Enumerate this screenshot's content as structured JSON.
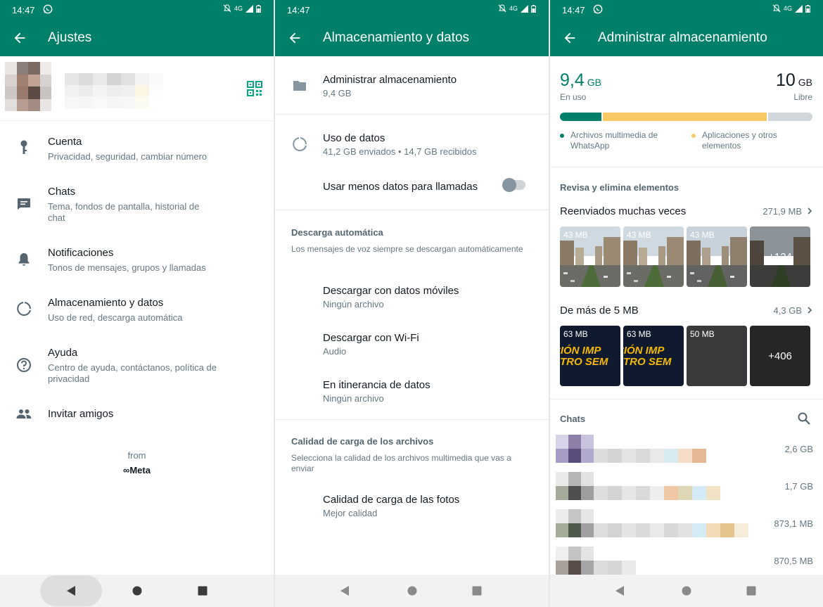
{
  "status_time": "14:47",
  "network": "4G",
  "settings": {
    "title": "Ajustes",
    "items": [
      {
        "label": "Cuenta",
        "sub": "Privacidad, seguridad, cambiar número"
      },
      {
        "label": "Chats",
        "sub": "Tema, fondos de pantalla, historial de chat"
      },
      {
        "label": "Notificaciones",
        "sub": "Tonos de mensajes, grupos y llamadas"
      },
      {
        "label": "Almacenamiento y datos",
        "sub": "Uso de red, descarga automática"
      },
      {
        "label": "Ayuda",
        "sub": "Centro de ayuda, contáctanos, política de privacidad"
      },
      {
        "label": "Invitar amigos"
      }
    ],
    "from": "from",
    "brand": "∞Meta"
  },
  "storage_data": {
    "title": "Almacenamiento y datos",
    "manage": {
      "label": "Administrar almacenamiento",
      "sub": "9,4 GB"
    },
    "usage": {
      "label": "Uso de datos",
      "sub": "41,2 GB enviados • 14,7 GB recibidos"
    },
    "less_data": {
      "label": "Usar menos datos para llamadas",
      "enabled": false
    },
    "auto_download": {
      "title": "Descarga automática",
      "desc": "Los mensajes de voz siempre se descargan automáticamente",
      "items": [
        {
          "label": "Descargar con datos móviles",
          "sub": "Ningún archivo"
        },
        {
          "label": "Descargar con Wi-Fi",
          "sub": "Audio"
        },
        {
          "label": "En itinerancia de datos",
          "sub": "Ningún archivo"
        }
      ]
    },
    "upload_quality": {
      "title": "Calidad de carga de los archivos",
      "desc": "Selecciona la calidad de los archivos multimedia que vas a enviar",
      "item": {
        "label": "Calidad de carga de las fotos",
        "sub": "Mejor calidad"
      }
    }
  },
  "manage_storage": {
    "title": "Administrar almacenamiento",
    "used": {
      "value": "9,4",
      "unit": "GB",
      "label": "En uso"
    },
    "free": {
      "value": "10",
      "unit": "GB",
      "label": "Libre"
    },
    "bar": {
      "whatsapp_fraction": 0.165,
      "apps_fraction": 0.655,
      "free_fraction": 0.18
    },
    "legend": {
      "whatsapp": "Archivos multimedia de WhatsApp",
      "apps": "Aplicaciones y otros elementos"
    },
    "review_title": "Revisa y elimina elementos",
    "forwarded": {
      "title": "Reenviados muchas veces",
      "size": "271,9 MB",
      "thumbs": [
        "43 MB",
        "43 MB",
        "43 MB"
      ],
      "more": "+124"
    },
    "large": {
      "title": "De más de 5 MB",
      "size": "4,3 GB",
      "thumbs": [
        "63 MB",
        "63 MB",
        "50 MB"
      ],
      "promo_text": "CIÓN IMP\nSTRO SEM",
      "more": "+406"
    },
    "chats_title": "Chats",
    "chats": [
      {
        "size": "2,6 GB"
      },
      {
        "size": "1,7 GB"
      },
      {
        "size": "873,1 MB"
      },
      {
        "size": "870,5 MB"
      }
    ]
  },
  "colors": {
    "primary": "#008069",
    "accent_green": "#00a884",
    "whatsapp_bar": "#008069",
    "apps_bar": "#f7c964",
    "free_bar": "#d1d7db"
  }
}
